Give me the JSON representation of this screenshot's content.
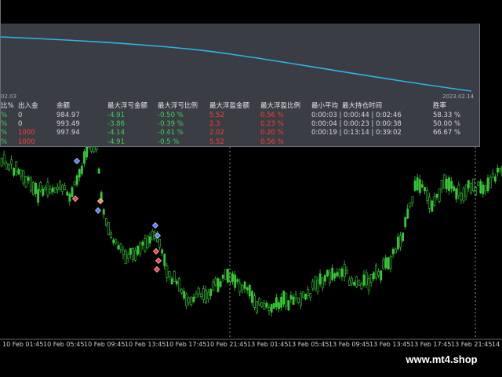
{
  "panel": {
    "date_start": "02.03",
    "date_end": "2023.02.14",
    "curve_color": "#29b6e8",
    "headers": [
      "比%",
      "出入金",
      "余额",
      "最大浮亏金额",
      "最大浮亏比例",
      "最大浮盈金额",
      "最大浮盈比例",
      "最小平均",
      "最大持仓时间",
      "胜率"
    ],
    "rows": [
      {
        "c0": "%",
        "deposit": "0",
        "balance": "984.97",
        "max_loss_amt": "-4.91",
        "max_loss_pct": "-0.50 %",
        "max_profit_amt": "5.52",
        "max_profit_pct": "0.56 %",
        "hold_time": "0:00:03 | 0:00:44 | 0:02:46",
        "win_rate": "58.33 %"
      },
      {
        "c0": "%",
        "deposit": "0",
        "balance": "993.49",
        "max_loss_amt": "-3.86",
        "max_loss_pct": "-0.39 %",
        "max_profit_amt": "2.3",
        "max_profit_pct": "0.23 %",
        "hold_time": "0:00:04 | 0:00:23 | 0:00:38",
        "win_rate": "50.00 %"
      },
      {
        "c0": "%",
        "deposit": "1000",
        "balance": "997.94",
        "max_loss_amt": "-4.14",
        "max_loss_pct": "-0.41 %",
        "max_profit_amt": "2.02",
        "max_profit_pct": "0.20 %",
        "hold_time": "0:00:19 | 0:13:14 | 0:39:02",
        "win_rate": "66.67 %"
      },
      {
        "c0": "%",
        "deposit": "1000",
        "balance": "",
        "max_loss_amt": "-4.91",
        "max_loss_pct": "-0.5 %",
        "max_profit_amt": "5.52",
        "max_profit_pct": "0.56 %",
        "hold_time": "",
        "win_rate": ""
      }
    ]
  },
  "time_axis": [
    "10 Feb 01:45",
    "10 Feb 05:45",
    "10 Feb 09:45",
    "10 Feb 13:45",
    "10 Feb 17:45",
    "10 Feb 21:45",
    "13 Feb 01:45",
    "13 Feb 05:45",
    "13 Feb 09:45",
    "13 Feb 13:45",
    "13 Feb 17:45",
    "13 Feb 21:45",
    "14 Fe"
  ],
  "watermark": "www.mt4.shop",
  "colors": {
    "candle": "#33cc33",
    "separator": "#bbbbbb",
    "background": "#000000"
  }
}
